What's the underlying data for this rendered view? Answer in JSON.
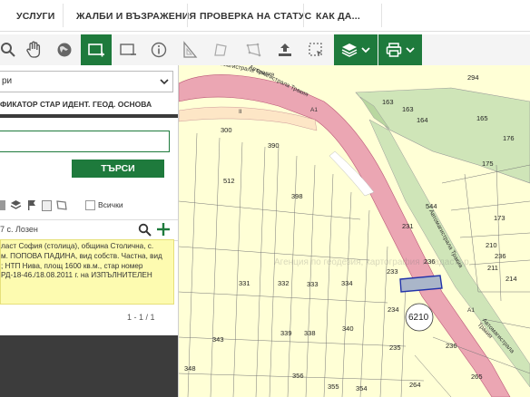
{
  "nav": {
    "items": [
      "УСЛУГИ",
      "ЖАЛБИ И ВЪЗРАЖЕНИЯ",
      "ПРОВЕРКА НА СТАТУС",
      "КАК ДА..."
    ]
  },
  "toolbar": {
    "icons": [
      "zoom-icon",
      "pan-hand-icon",
      "globe-icon",
      "select-rect-icon",
      "deselect-icon",
      "info-icon",
      "measure-icon",
      "area-icon",
      "upload-icon",
      "select-area-icon",
      "layers-icon",
      "print-icon"
    ]
  },
  "panel": {
    "select_value": "ри",
    "tabs": [
      "ФИКАТОР",
      "СТАР ИДЕНТ.",
      "ГЕОД. ОСНОВА"
    ],
    "search_value": "",
    "search_button": "ТЪРСИ",
    "filter_all": "Всички",
    "result_title": "7 с. Лозен",
    "result_lines": [
      "ласт София (столица), община Столична, с.",
      "м. ПОПОВА ПАДИНА, вид собств. Частна, вид",
      "; НТП Нива, площ 1600 кв.м., стар номер",
      "РД-18-46./18.08.2011 г. на ИЗПЪЛНИТЕЛЕН"
    ],
    "pager": "1 - 1 / 1"
  },
  "map": {
    "road_labels": [
      "Автомагистрала Тракия",
      "Автомагистрала Тракия",
      "Автомагистрала Тракия",
      "Автомагистрала Тракия"
    ],
    "road_codes": [
      "A1",
      "II",
      "A1"
    ],
    "watermark": "Агенция по геодезия, картография и кадастър",
    "parcel_labels": [
      {
        "t": "294"
      },
      {
        "t": "163"
      },
      {
        "t": "163"
      },
      {
        "t": "164"
      },
      {
        "t": "165"
      },
      {
        "t": "176"
      },
      {
        "t": "175"
      },
      {
        "t": "300"
      },
      {
        "t": "390"
      },
      {
        "t": "512"
      },
      {
        "t": "398"
      },
      {
        "t": "544"
      },
      {
        "t": "173"
      },
      {
        "t": "231"
      },
      {
        "t": "210"
      },
      {
        "t": "236"
      },
      {
        "t": "211"
      },
      {
        "t": "214"
      },
      {
        "t": "233"
      },
      {
        "t": "236"
      },
      {
        "t": "331"
      },
      {
        "t": "332"
      },
      {
        "t": "333"
      },
      {
        "t": "334"
      },
      {
        "t": "234"
      },
      {
        "t": "343"
      },
      {
        "t": "339"
      },
      {
        "t": "338"
      },
      {
        "t": "235"
      },
      {
        "t": "236"
      },
      {
        "t": "348"
      },
      {
        "t": "340"
      },
      {
        "t": "265"
      },
      {
        "t": "264"
      },
      {
        "t": "356"
      },
      {
        "t": "355"
      },
      {
        "t": "354"
      }
    ],
    "cadastral_number": "6210"
  },
  "colors": {
    "accent": "#1e7a3c",
    "map_bg": "#ffffd6",
    "road": "#e89aa8",
    "highlight": "#9fb0c8"
  }
}
